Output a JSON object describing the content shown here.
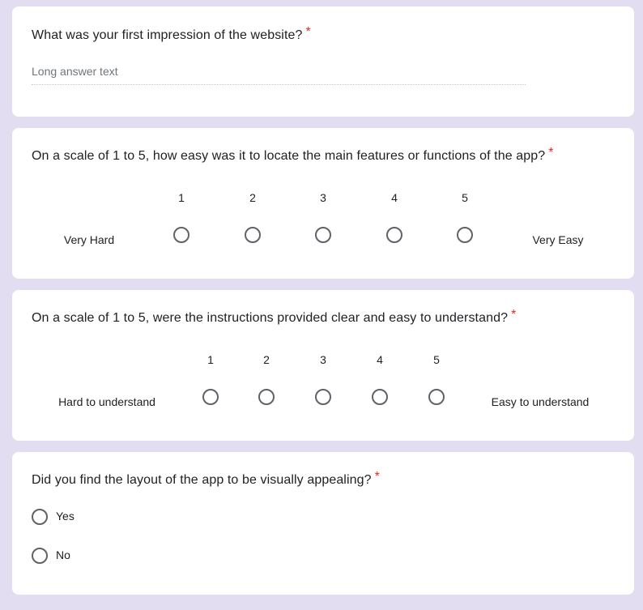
{
  "questions": [
    {
      "title": "What was your first impression of the website?",
      "required_mark": "*",
      "placeholder": "Long answer text"
    },
    {
      "title": "On a scale of 1 to 5, how easy was it to locate the main features or functions of the app?",
      "required_mark": "*",
      "scale": [
        "1",
        "2",
        "3",
        "4",
        "5"
      ],
      "low_label": "Very Hard",
      "high_label": "Very Easy"
    },
    {
      "title": "On a scale of 1 to 5, were the instructions provided clear and easy to understand?",
      "required_mark": "*",
      "scale": [
        "1",
        "2",
        "3",
        "4",
        "5"
      ],
      "low_label": "Hard to understand",
      "high_label": "Easy to understand"
    },
    {
      "title": "Did you find the layout of the app to be visually appealing?",
      "required_mark": "*",
      "options": [
        "Yes",
        "No"
      ]
    }
  ],
  "colors": {
    "background": "#e3ddf1",
    "card": "#ffffff",
    "required": "#d93025",
    "radio_border": "#5f6368"
  }
}
